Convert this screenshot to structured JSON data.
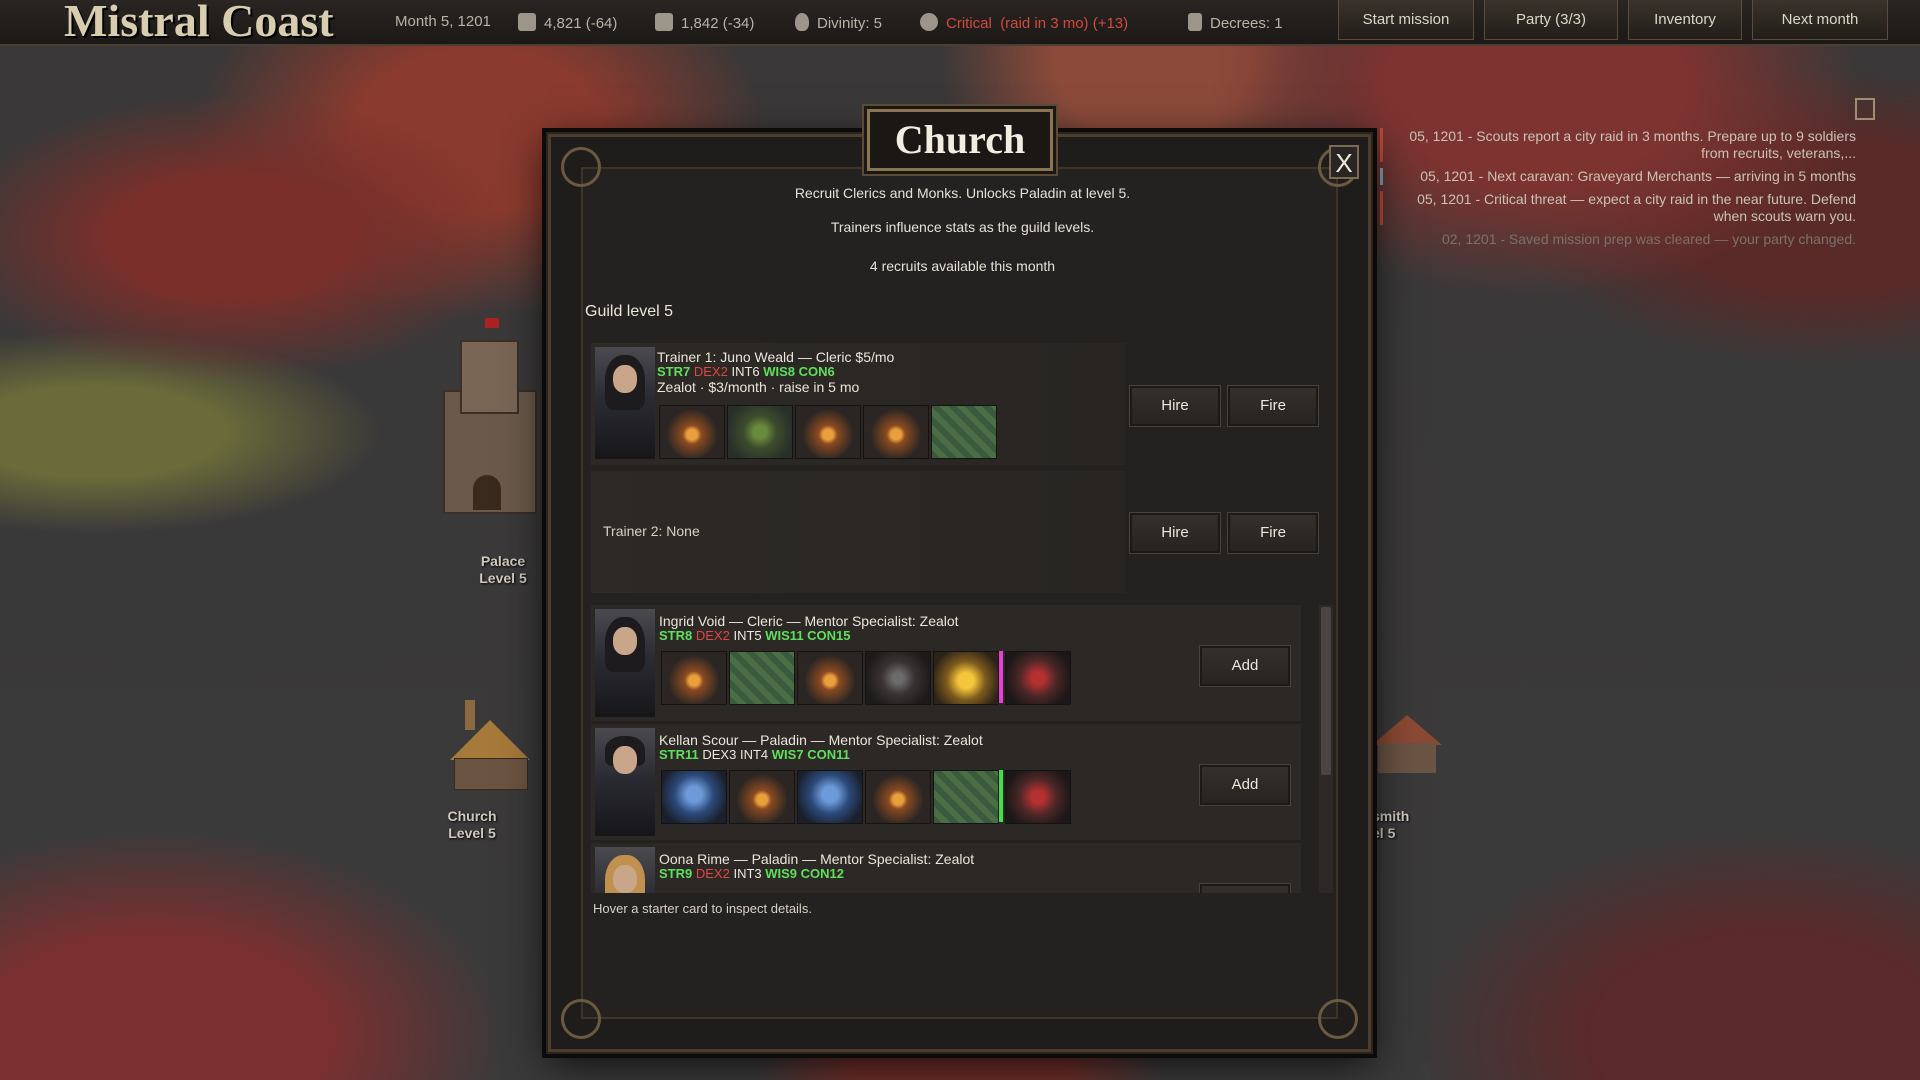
{
  "topbar": {
    "title": "Mistral Coast",
    "date": "Month 5, 1201",
    "gold": "4,821 (-64)",
    "food": "1,842 (-34)",
    "divinity": "Divinity: 5",
    "threat_label": "Critical",
    "threat_detail": "(raid in 3 mo) (+13)",
    "decrees": "Decrees: 1",
    "buttons": {
      "start_mission": "Start mission",
      "party": "Party (3/3)",
      "inventory": "Inventory",
      "next_month": "Next month"
    }
  },
  "map": {
    "palace_label": "Palace",
    "palace_level": "Level 5",
    "church_label": "Church",
    "church_level": "Level 5",
    "smith_label": "smith",
    "smith_level": "el 5"
  },
  "log": [
    "05, 1201 - Scouts report a city raid in 3 months. Prepare up to 9 soldiers from recruits, veterans,...",
    "05, 1201 - Next caravan: Graveyard Merchants — arriving in 5 months",
    "05, 1201 - Critical threat — expect a city raid in the near future. Defend when scouts warn you.",
    "02, 1201 - Saved mission prep was cleared — your party changed."
  ],
  "modal": {
    "title": "Church",
    "close": "X",
    "desc1": "Recruit Clerics and Monks. Unlocks Paladin at level 5.",
    "desc2": "Trainers influence stats as the guild levels.",
    "desc3": "4 recruits available this month",
    "guild_level": "Guild level 5",
    "trainer1": {
      "name": "Trainer 1: Juno Weald — Cleric  $5/mo",
      "str": "STR7",
      "dex": "DEX2",
      "int": "INT6",
      "wis": "WIS8",
      "con": "CON6",
      "sub": "Zealot · $3/month · raise in 5 mo"
    },
    "trainer2": {
      "name": "Trainer 2: None"
    },
    "hire": "Hire",
    "fire": "Fire",
    "add": "Add",
    "recruits": [
      {
        "name": "Ingrid Void — Cleric — Mentor Specialist: Zealot",
        "str": "STR8",
        "dex": "DEX2",
        "int": "INT5",
        "wis": "WIS11",
        "con": "CON15"
      },
      {
        "name": "Kellan Scour — Paladin — Mentor Specialist: Zealot",
        "str": "STR11",
        "dex": "DEX3",
        "int": "INT4",
        "wis": "WIS7",
        "con": "CON11"
      },
      {
        "name": "Oona Rime — Paladin — Mentor Specialist: Zealot",
        "str": "STR9",
        "dex": "DEX2",
        "int": "INT3",
        "wis": "WIS9",
        "con": "CON12"
      }
    ],
    "hint": "Hover a starter card to inspect details."
  },
  "colors": {
    "stat_high": "#5fe05a",
    "stat_low": "#e2463f",
    "threat": "#d24a3e",
    "divider_pink": "#e83fd6",
    "divider_green": "#3fe04a"
  }
}
